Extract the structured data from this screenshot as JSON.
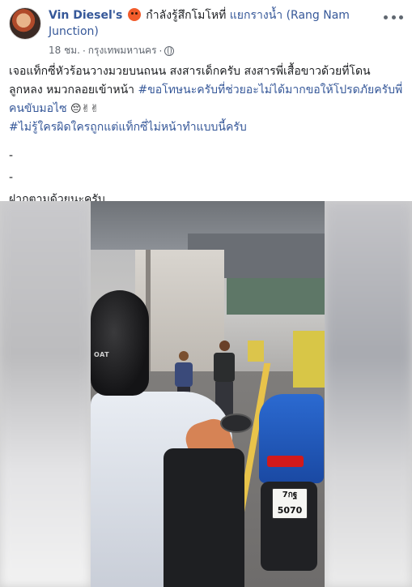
{
  "post": {
    "author": "Vin Diesel's",
    "feeling": {
      "prefix": "กำลังรู้สึกโมโหที่",
      "location": "แยกรางน้ำ (Rang Nam Junction)"
    },
    "time": "18 ชม.",
    "separator": "·",
    "place": "กรุงเทพมหานคร",
    "separator2": "·",
    "privacy_icon": "globe-icon",
    "more_icon": "more-options-icon"
  },
  "body": {
    "line1": "เจอแท็กซี่หัวร้อนวางมวยบนถนน สงสารเด็กครับ สงสารพี่เสื้อขาวด้วยที่โดนลูกหลง หมวกลอยเข้าหน้า",
    "hashtag1": "#ขอโทษนะครับที่ช่วยอะไม่ได้มากขอให้โปรดภัยครับพี่คนขับมอไซ",
    "emojis1": "😔✌✌",
    "hashtag2": "#ไม่รู้ใครผิดใครถูกแต่แท็กซี่ไม่หน้าทำแบบนี้ครับ",
    "dash1": "-",
    "dash2": "-",
    "closing": "ฝากตามด้วยนะครับ"
  },
  "media": {
    "helmet_text": "OAT",
    "plate_line1": "7กฐ",
    "plate_line2": "5070"
  },
  "colors": {
    "link": "#365899",
    "text": "#1c1e21",
    "meta": "#616770"
  }
}
